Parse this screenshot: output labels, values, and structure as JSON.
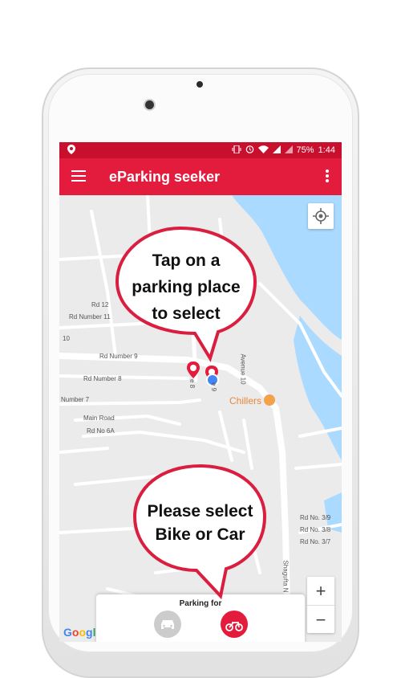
{
  "status_bar": {
    "battery": "75%",
    "time": "1:44"
  },
  "app_bar": {
    "title": "eParking seeker"
  },
  "map": {
    "street_labels": [
      "Rd 12",
      "Rd Number 11",
      "10",
      "Rd Number 9",
      "Rd Number 8",
      "Number 7",
      "Main Road",
      "Rd No 6A",
      "Avenue 10",
      "e 8",
      "e 9",
      "Rd No. 3/9",
      "Rd No. 3/8",
      "Rd No. 3/7",
      "Shagufta N"
    ],
    "place_label": "Chillers",
    "attribution": "Google"
  },
  "callouts": {
    "top": [
      "Tap on a",
      "parking place",
      "to select"
    ],
    "bottom": [
      "Please select",
      "Bike or Car"
    ]
  },
  "bottom_sheet": {
    "caption": "Parking for",
    "selected": "bike"
  },
  "zoom": {
    "in": "+",
    "out": "−"
  },
  "colors": {
    "primary": "#e31b3c",
    "status_bar": "#c8102e",
    "water": "#aadaff",
    "callout_border": "#d91e3f"
  }
}
